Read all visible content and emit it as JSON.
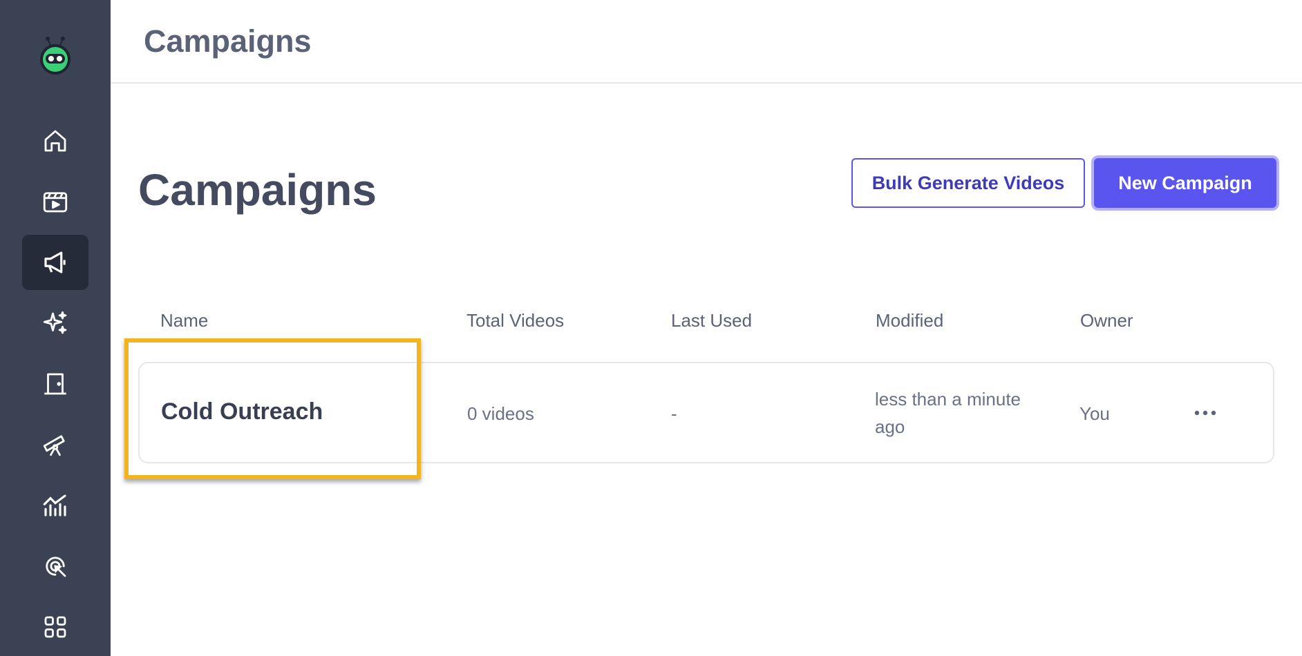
{
  "colors": {
    "sidebar": "#3a4254",
    "sidebar_active": "#252b38",
    "accent": "#5b55f0",
    "highlight": "#f2b51f"
  },
  "topbar": {
    "title": "Campaigns"
  },
  "sidebar": {
    "items": [
      {
        "icon": "home-icon",
        "active": false
      },
      {
        "icon": "video-icon",
        "active": false
      },
      {
        "icon": "megaphone-icon",
        "active": true
      },
      {
        "icon": "sparkles-icon",
        "active": false
      },
      {
        "icon": "door-icon",
        "active": false
      },
      {
        "icon": "telescope-icon",
        "active": false
      },
      {
        "icon": "analytics-icon",
        "active": false
      },
      {
        "icon": "target-cursor-icon",
        "active": false
      },
      {
        "icon": "apps-grid-icon",
        "active": false
      }
    ]
  },
  "main": {
    "title": "Campaigns",
    "bulk_button": "Bulk Generate Videos",
    "new_button": "New Campaign",
    "table": {
      "headers": [
        "Name",
        "Total Videos",
        "Last Used",
        "Modified",
        "Owner"
      ],
      "rows": [
        {
          "name": "Cold Outreach",
          "total_videos": "0 videos",
          "last_used": "-",
          "modified": "less than a minute ago",
          "owner": "You"
        }
      ]
    }
  }
}
